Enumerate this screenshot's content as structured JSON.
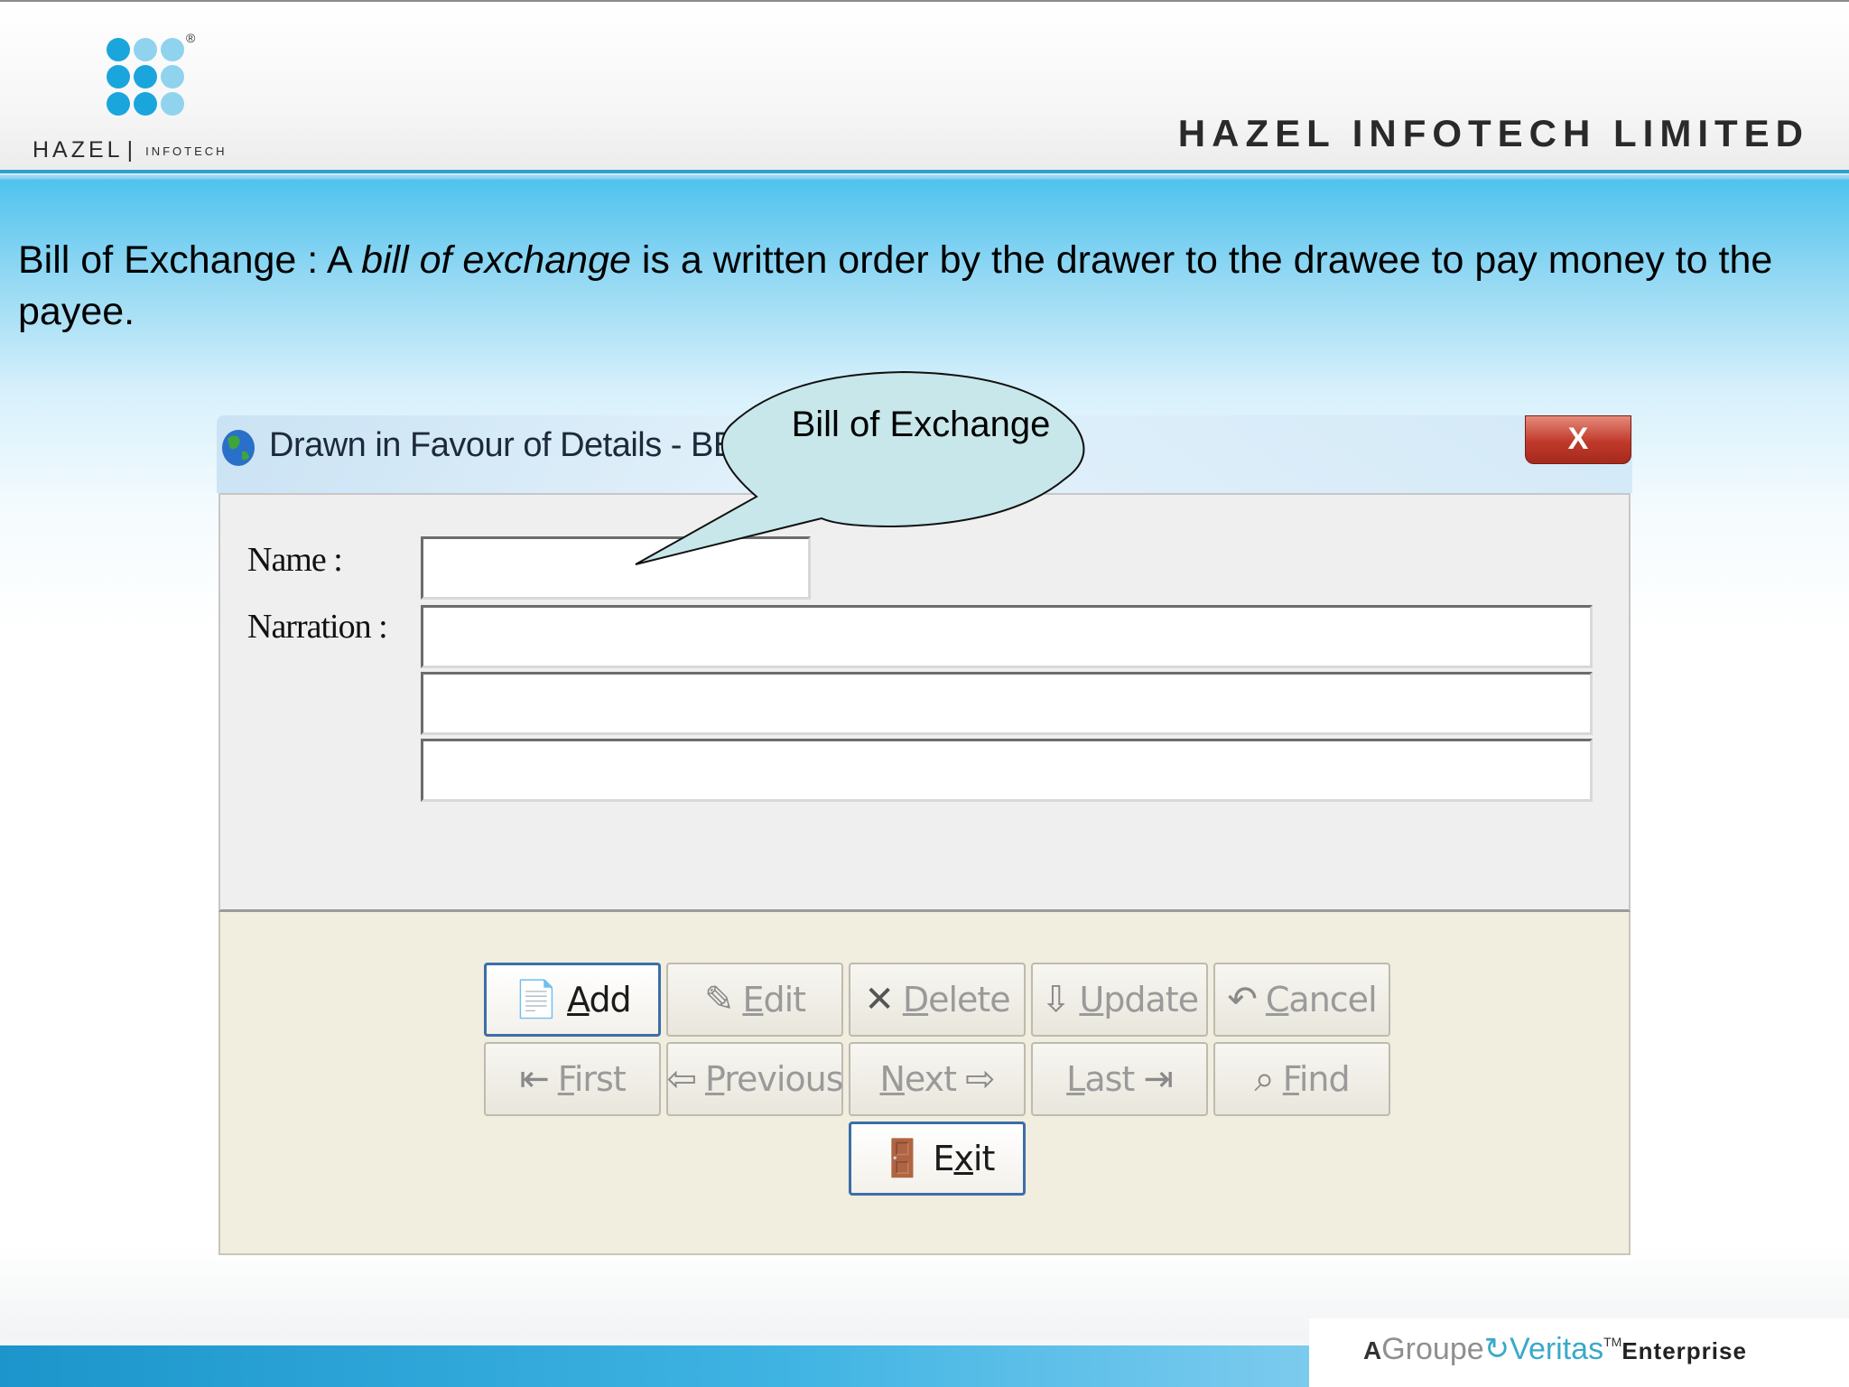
{
  "header": {
    "logo_brand": "HAZEL",
    "logo_sub": "INFOTECH",
    "logo_reg": "®",
    "company": "HAZEL INFOTECH LIMITED"
  },
  "definition": {
    "term": "Bill of Exchange : A ",
    "italic": "bill of exchange",
    "rest": " is a written order by the drawer to the drawee to pay money to the payee."
  },
  "callout": {
    "text": "Bill of Exchange"
  },
  "dialog": {
    "title": "Drawn in Favour of Details - BE",
    "close_label": "X",
    "name_label": "Name :",
    "narration_label": "Narration :",
    "name_value": "",
    "narration_lines": [
      "",
      "",
      ""
    ]
  },
  "buttons": {
    "add": {
      "pre": "",
      "u": "A",
      "post": "dd",
      "icon": "add-document-icon",
      "enabled": true
    },
    "edit": {
      "pre": "",
      "u": "E",
      "post": "dit",
      "icon": "edit-icon",
      "enabled": false
    },
    "delete": {
      "pre": "",
      "u": "D",
      "post": "elete",
      "icon": "delete-icon",
      "enabled": false
    },
    "update": {
      "pre": "",
      "u": "U",
      "post": "pdate",
      "icon": "update-icon",
      "enabled": false
    },
    "cancel": {
      "pre": "",
      "u": "C",
      "post": "ancel",
      "icon": "cancel-icon",
      "enabled": false
    },
    "first": {
      "pre": "",
      "u": "F",
      "post": "irst",
      "icon": "first-record-icon",
      "enabled": false
    },
    "previous": {
      "pre": "",
      "u": "P",
      "post": "revious",
      "icon": "previous-record-icon",
      "enabled": false
    },
    "next": {
      "pre": "",
      "u": "N",
      "post": "ext",
      "icon": "next-record-icon",
      "enabled": false
    },
    "last": {
      "pre": "",
      "u": "L",
      "post": "ast",
      "icon": "last-record-icon",
      "enabled": false
    },
    "find": {
      "pre": "",
      "u": "F",
      "post": "ind",
      "icon": "find-icon",
      "enabled": false
    },
    "exit": {
      "pre": "E",
      "u": "x",
      "post": "it",
      "icon": "exit-door-icon",
      "enabled": true
    }
  },
  "footer": {
    "a": "A",
    "groupe": "Groupe",
    "veritas": "Veritas",
    "tm": "TM",
    "enterprise": "Enterprise"
  },
  "colors": {
    "accent_blue": "#2ea0cf",
    "dialog_button_area": "#f1eddf",
    "callout_fill": "#c7e7ea",
    "close_red": "#c0392b"
  }
}
